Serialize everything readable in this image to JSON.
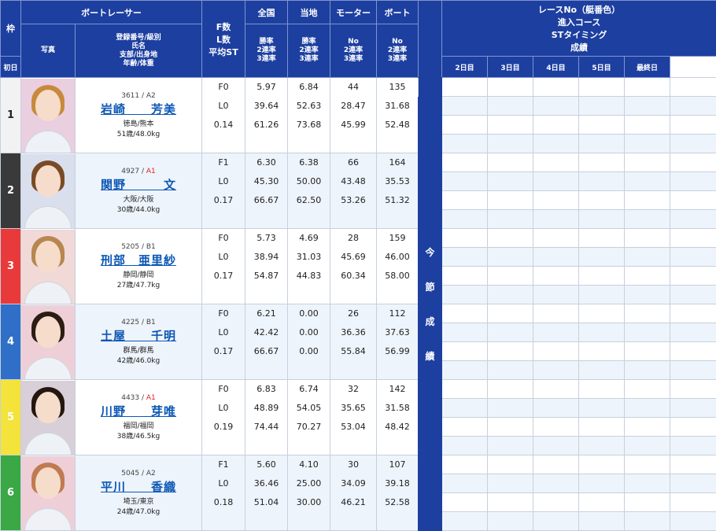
{
  "header": {
    "waku": "枠",
    "boat_racer": "ボートレーサー",
    "zenkoku": "全国",
    "touchi": "当地",
    "motor": "モーター",
    "boat": "ボート",
    "race_info": [
      "レースNo（艇番色）",
      "進入コース",
      "STタイミング",
      "成績"
    ],
    "photo": "写真",
    "racer_info": [
      "登録番号/級別",
      "氏名",
      "支部/出身地",
      "年齢/体重"
    ],
    "fl": [
      "F数",
      "L数",
      "平均ST"
    ],
    "win_rate": [
      "勝率",
      "2連率",
      "3連率"
    ],
    "motor_sub": [
      "No",
      "2連率",
      "3連率"
    ],
    "boat_sub": [
      "No",
      "2連率",
      "3連率"
    ],
    "days": [
      "初日",
      "2日目",
      "3日目",
      "4日目",
      "5日目",
      "最終日"
    ],
    "konsetsu": [
      "今",
      "節",
      "成",
      "績"
    ]
  },
  "colors": {
    "w1": "#ffffff",
    "w2": "#3a3a3a",
    "w3": "#e83a3a",
    "w4": "#2f6fc7",
    "w5": "#f3e33a",
    "w6": "#39a845"
  },
  "racers": [
    {
      "waku": "1",
      "reg": "3611",
      "cls": "A2",
      "name": "岩崎　　芳美",
      "place": "徳島/熊本",
      "agewt": "51歳/48.0kg",
      "f": "F0",
      "l": "L0",
      "st": "0.14",
      "zen": [
        "5.97",
        "39.64",
        "61.26"
      ],
      "tou": [
        "6.84",
        "52.63",
        "73.68"
      ],
      "motor": [
        "44",
        "28.47",
        "45.99"
      ],
      "boat": [
        "135",
        "31.68",
        "52.48"
      ]
    },
    {
      "waku": "2",
      "reg": "4927",
      "cls": "A1",
      "name": "関野　　　文",
      "place": "大阪/大阪",
      "agewt": "30歳/44.0kg",
      "f": "F1",
      "l": "L0",
      "st": "0.17",
      "zen": [
        "6.30",
        "45.30",
        "66.67"
      ],
      "tou": [
        "6.38",
        "50.00",
        "62.50"
      ],
      "motor": [
        "66",
        "43.48",
        "53.26"
      ],
      "boat": [
        "164",
        "35.53",
        "51.32"
      ]
    },
    {
      "waku": "3",
      "reg": "5205",
      "cls": "B1",
      "name": "刑部　亜里紗",
      "place": "静岡/静岡",
      "agewt": "27歳/47.7kg",
      "f": "F0",
      "l": "L0",
      "st": "0.17",
      "zen": [
        "5.73",
        "38.94",
        "54.87"
      ],
      "tou": [
        "4.69",
        "31.03",
        "44.83"
      ],
      "motor": [
        "28",
        "45.69",
        "60.34"
      ],
      "boat": [
        "159",
        "46.00",
        "58.00"
      ]
    },
    {
      "waku": "4",
      "reg": "4225",
      "cls": "B1",
      "name": "土屋　　千明",
      "place": "群馬/群馬",
      "agewt": "42歳/46.0kg",
      "f": "F0",
      "l": "L0",
      "st": "0.17",
      "zen": [
        "6.21",
        "42.42",
        "66.67"
      ],
      "tou": [
        "0.00",
        "0.00",
        "0.00"
      ],
      "motor": [
        "26",
        "36.36",
        "55.84"
      ],
      "boat": [
        "112",
        "37.63",
        "56.99"
      ]
    },
    {
      "waku": "5",
      "reg": "4433",
      "cls": "A1",
      "name": "川野　　芽唯",
      "place": "福岡/福岡",
      "agewt": "38歳/46.5kg",
      "f": "F0",
      "l": "L0",
      "st": "0.19",
      "zen": [
        "6.83",
        "48.89",
        "74.44"
      ],
      "tou": [
        "6.74",
        "54.05",
        "70.27"
      ],
      "motor": [
        "32",
        "35.65",
        "53.04"
      ],
      "boat": [
        "142",
        "31.58",
        "48.42"
      ]
    },
    {
      "waku": "6",
      "reg": "5045",
      "cls": "A2",
      "name": "平川　　香織",
      "place": "埼玉/東京",
      "agewt": "24歳/47.0kg",
      "f": "F1",
      "l": "L0",
      "st": "0.18",
      "zen": [
        "5.60",
        "36.46",
        "51.04"
      ],
      "tou": [
        "4.10",
        "25.00",
        "30.00"
      ],
      "motor": [
        "30",
        "34.09",
        "46.21"
      ],
      "boat": [
        "107",
        "39.18",
        "52.58"
      ]
    }
  ]
}
